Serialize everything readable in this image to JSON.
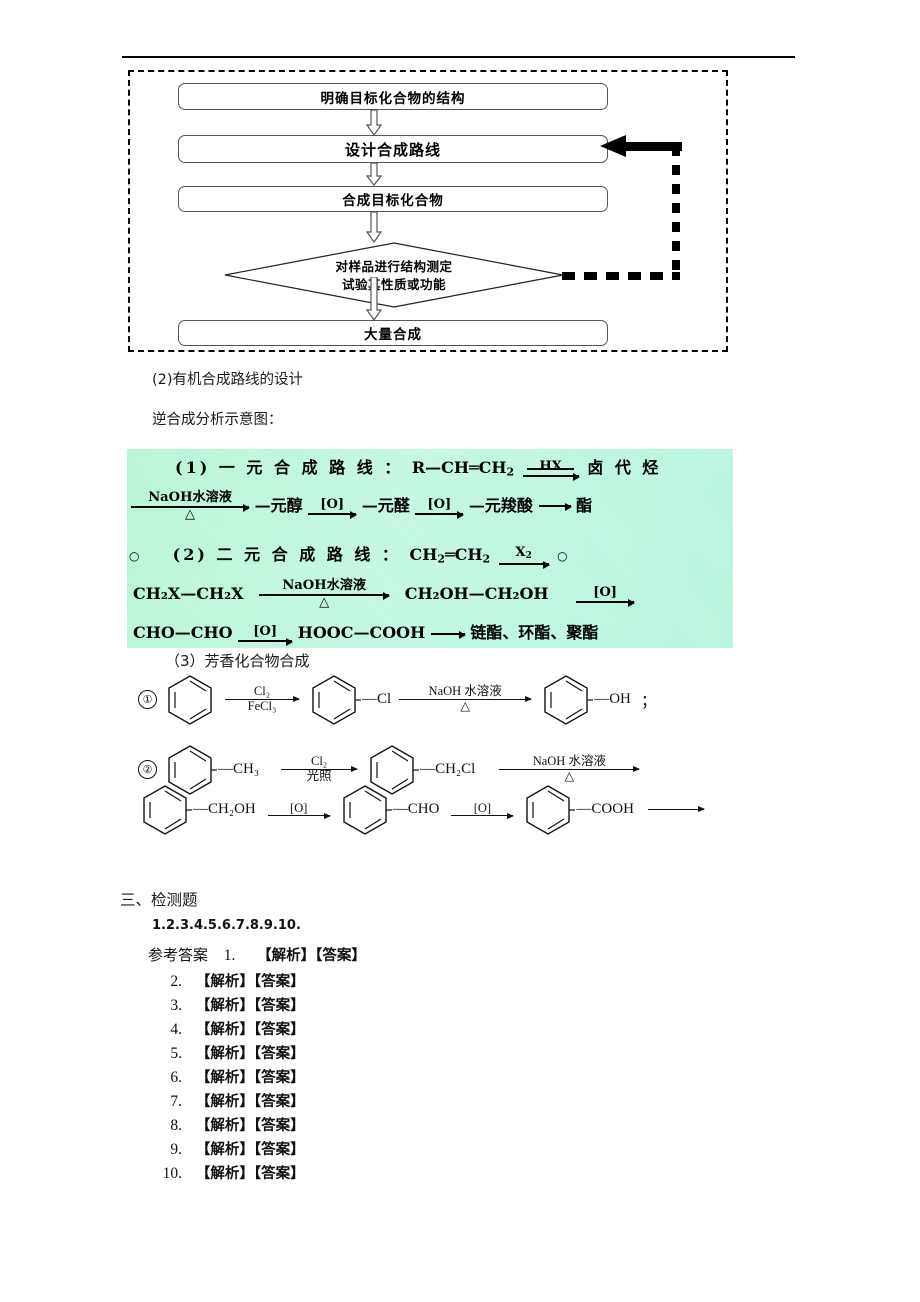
{
  "document": {
    "header_rule": true
  },
  "flowchart": {
    "boxes": [
      {
        "id": "b1",
        "label": "明确目标化合物的结构"
      },
      {
        "id": "b2",
        "label": "设计合成路线"
      },
      {
        "id": "b3",
        "label": "合成目标化合物"
      },
      {
        "id": "b5",
        "label": "大量合成"
      }
    ],
    "decision": {
      "line1": "对样品进行结构测定",
      "line2": "试验其性质或功能"
    },
    "feedback_note": "虚线反馈回路指向“设计合成路线”"
  },
  "section2": {
    "heading": "(2)有机合成路线的设计",
    "subheading": "逆合成分析示意图："
  },
  "green_block": {
    "line1_prefix": "(1)",
    "line1_title": "一 元 合 成 路 线 ：",
    "line1_start": "R—CH═CH",
    "line1_start_sub": "2",
    "line1_reagent": "HX",
    "line1_product": "卤 代 烃",
    "line2_reagent_top": "NaOH水溶液",
    "line2_reagent_bottom": "△",
    "line2_a": "—元醇",
    "line2_ox1": "[O]",
    "line2_b": "—元醛",
    "line2_ox2": "[O]",
    "line2_c": "—元羧酸",
    "line2_d": "酯",
    "line3_circle": "○",
    "line3_prefix": "(2)",
    "line3_title": "二 元 合 成 路 线 ：",
    "line3_start": "CH",
    "line3_start_sub": "2",
    "line3_mid": "═CH",
    "line3_mid_sub": "2",
    "line3_reagent": "X",
    "line3_reagent_sub": "2",
    "line3_tail": "○",
    "line4_a": "CH₂X—CH₂X",
    "line4_reagent_top": "NaOH水溶液",
    "line4_reagent_bottom": "△",
    "line4_b": "CH₂OH—CH₂OH",
    "line4_ox": "[O]",
    "line5_a": "CHO—CHO",
    "line5_ox": "[O]",
    "line5_b": "HOOC—COOH",
    "line5_c": "链酯、环酯、聚酯"
  },
  "section3": {
    "heading": "（3）芳香化合物合成",
    "reactions": [
      {
        "number": "①",
        "steps": [
          {
            "substituent": "",
            "reagent_top": "Cl₂",
            "reagent_bottom": "FeCl₃"
          },
          {
            "substituent": "—Cl",
            "reagent_top": "NaOH 水溶液",
            "reagent_bottom": "△"
          },
          {
            "substituent": "—OH",
            "reagent_top": "",
            "reagent_bottom": ""
          }
        ],
        "terminator": "；"
      },
      {
        "number": "②",
        "steps": [
          {
            "substituent": "—CH₃",
            "reagent_top": "Cl₂",
            "reagent_bottom": "光照"
          },
          {
            "substituent": "—CH₂Cl",
            "reagent_top": "NaOH 水溶液",
            "reagent_bottom": "△"
          }
        ],
        "terminator": ""
      },
      {
        "number": "",
        "steps": [
          {
            "substituent": "—CH₂OH",
            "reagent_top": "[O]",
            "reagent_bottom": ""
          },
          {
            "substituent": "—CHO",
            "reagent_top": "[O]",
            "reagent_bottom": ""
          },
          {
            "substituent": "—COOH",
            "reagent_top": "",
            "reagent_bottom": ""
          }
        ],
        "terminator": ""
      }
    ]
  },
  "section_test": {
    "heading": "三、检测题",
    "question_numbers": "1.2.3.4.5.6.7.8.9.10.",
    "answers_label": "参考答案",
    "answer_marks": "【解析】【答案】",
    "answers": [
      {
        "num": "1.",
        "text": "【解析】【答案】"
      },
      {
        "num": "2.",
        "text": "【解析】【答案】"
      },
      {
        "num": "3.",
        "text": "【解析】【答案】"
      },
      {
        "num": "4.",
        "text": "【解析】【答案】"
      },
      {
        "num": "5.",
        "text": "【解析】【答案】"
      },
      {
        "num": "6.",
        "text": "【解析】【答案】"
      },
      {
        "num": "7.",
        "text": "【解析】【答案】"
      },
      {
        "num": "8.",
        "text": "【解析】【答案】"
      },
      {
        "num": "9.",
        "text": "【解析】【答案】"
      },
      {
        "num": "10.",
        "text": "【解析】【答案】"
      }
    ]
  },
  "colors": {
    "green_block_bg": "#b0f5d6",
    "text": "#000000",
    "box_border": "#555555"
  }
}
